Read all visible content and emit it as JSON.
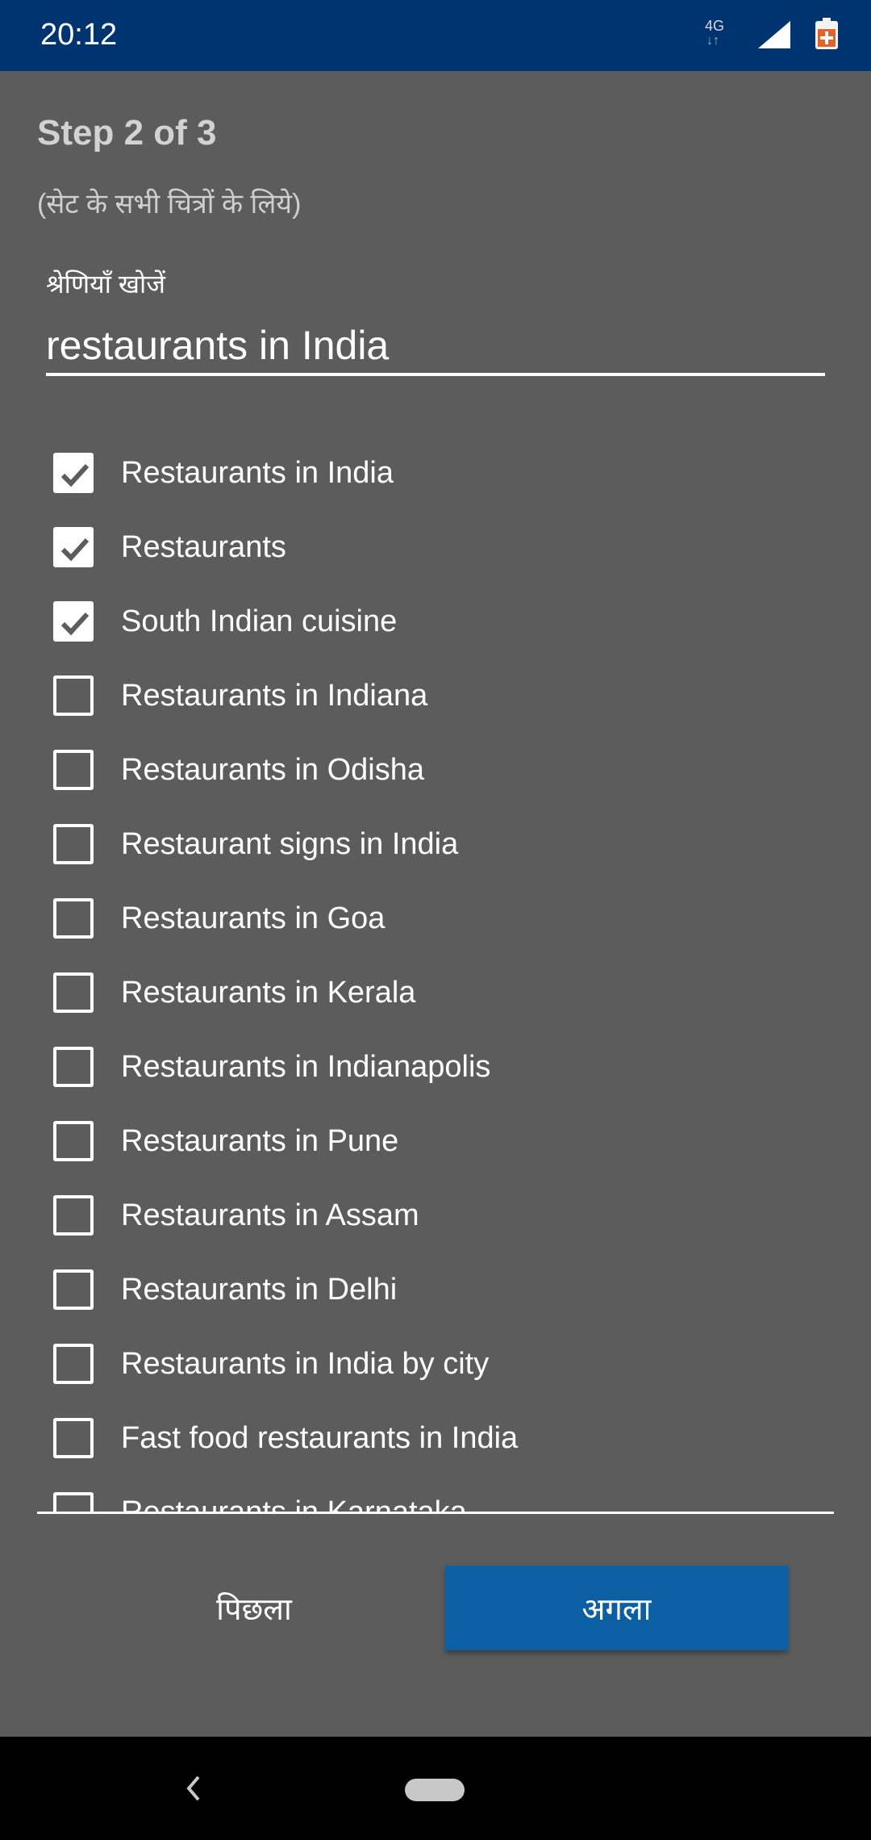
{
  "status_bar": {
    "time": "20:12",
    "network": "4G",
    "icons": [
      "network-4g-icon",
      "signal-icon",
      "battery-icon"
    ]
  },
  "step": {
    "title": "Step 2 of 3",
    "subtitle": "(सेट के सभी चित्रों के लिये)"
  },
  "search": {
    "label": "श्रेणियाँ खोजें",
    "value": "restaurants in India"
  },
  "categories": [
    {
      "label": "Restaurants in India",
      "checked": true
    },
    {
      "label": "Restaurants",
      "checked": true
    },
    {
      "label": "South Indian cuisine",
      "checked": true
    },
    {
      "label": "Restaurants in Indiana",
      "checked": false
    },
    {
      "label": "Restaurants in Odisha",
      "checked": false
    },
    {
      "label": "Restaurant signs in India",
      "checked": false
    },
    {
      "label": "Restaurants in Goa",
      "checked": false
    },
    {
      "label": "Restaurants in Kerala",
      "checked": false
    },
    {
      "label": "Restaurants in Indianapolis",
      "checked": false
    },
    {
      "label": "Restaurants in Pune",
      "checked": false
    },
    {
      "label": "Restaurants in Assam",
      "checked": false
    },
    {
      "label": "Restaurants in Delhi",
      "checked": false
    },
    {
      "label": "Restaurants in India by city",
      "checked": false
    },
    {
      "label": "Fast food restaurants in India",
      "checked": false
    },
    {
      "label": "Restaurants in Karnataka",
      "checked": false
    }
  ],
  "buttons": {
    "previous": "पिछला",
    "next": "अगला"
  },
  "colors": {
    "status_bar": "#003470",
    "background": "#5c5c5c",
    "next_button": "#0c5fa3",
    "nav_bar": "#000000"
  }
}
